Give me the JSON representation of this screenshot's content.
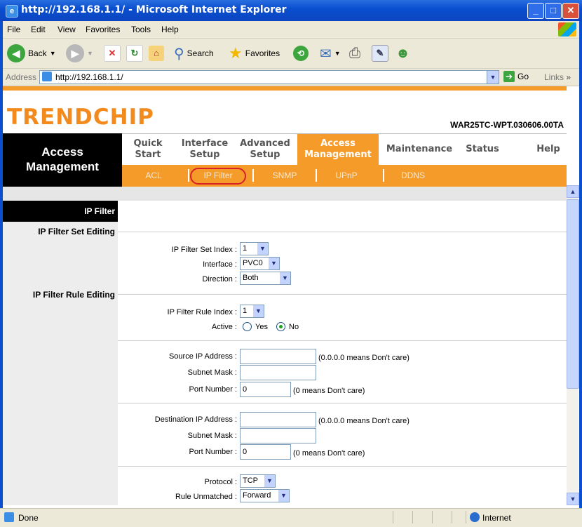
{
  "window": {
    "title": "http://192.168.1.1/ - Microsoft Internet Explorer",
    "buttons": {
      "minimize": "_",
      "maximize": "□",
      "close": "✕"
    }
  },
  "menu": [
    "File",
    "Edit",
    "View",
    "Favorites",
    "Tools",
    "Help"
  ],
  "toolbar": {
    "back": "Back",
    "search": "Search",
    "favorites": "Favorites"
  },
  "address": {
    "label": "Address",
    "url": "http://192.168.1.1/",
    "go": "Go",
    "links": "Links"
  },
  "page": {
    "logo": "TRENDCHIP",
    "model": "WAR25TC-WPT.030606.00TA",
    "section": [
      "Access",
      "Management"
    ],
    "nav": [
      {
        "line1": "Quick",
        "line2": "Start"
      },
      {
        "line1": "Interface",
        "line2": "Setup"
      },
      {
        "line1": "Advanced",
        "line2": "Setup"
      },
      {
        "line1": "Access",
        "line2": "Management"
      },
      {
        "line1": "Maintenance",
        "line2": ""
      },
      {
        "line1": "Status",
        "line2": ""
      },
      {
        "line1": "Help",
        "line2": ""
      }
    ],
    "subnav": [
      "ACL",
      "IP Filter",
      "SNMP",
      "UPnP",
      "DDNS"
    ],
    "panel_title": "IP Filter",
    "set_editing": "IP Filter Set Editing",
    "rule_editing": "IP Filter Rule Editing",
    "fields": {
      "set_index": {
        "label": "IP Filter Set Index :",
        "value": "1"
      },
      "interface": {
        "label": "Interface :",
        "value": "PVC0"
      },
      "direction": {
        "label": "Direction :",
        "value": "Both"
      },
      "rule_index": {
        "label": "IP Filter Rule Index :",
        "value": "1"
      },
      "active": {
        "label": "Active :",
        "yes": "Yes",
        "no": "No",
        "selected": "No"
      },
      "src_ip": {
        "label": "Source IP Address :",
        "value": "",
        "hint": "(0.0.0.0 means Don't care)"
      },
      "src_mask": {
        "label": "Subnet Mask :",
        "value": ""
      },
      "src_port": {
        "label": "Port Number :",
        "value": "0",
        "hint": "(0 means Don't care)"
      },
      "dst_ip": {
        "label": "Destination IP Address :",
        "value": "",
        "hint": "(0.0.0.0 means Don't care)"
      },
      "dst_mask": {
        "label": "Subnet Mask :",
        "value": ""
      },
      "dst_port": {
        "label": "Port Number :",
        "value": "0",
        "hint": "(0 means Don't care)"
      },
      "protocol": {
        "label": "Protocol :",
        "value": "TCP"
      },
      "unmatched": {
        "label": "Rule Unmatched :",
        "value": "Forward"
      }
    }
  },
  "status": {
    "text": "Done",
    "zone": "Internet"
  },
  "colors": {
    "accent": "#f59b2a",
    "titlebar": "#0a4fd0",
    "logo": "#f28a1e"
  }
}
